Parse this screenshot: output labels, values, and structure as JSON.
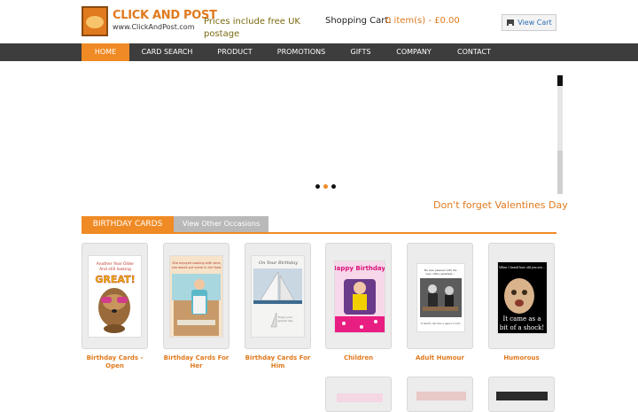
{
  "header": {
    "logo_title": "CLICK AND POST",
    "logo_subtitle": "www.ClickAndPost.com",
    "tagline": "Prices include free UK postage",
    "cart_label": "Shopping Cart:",
    "cart_value": "0 item(s) - £0.00",
    "view_cart": "View Cart",
    "cart_icon": "cart-icon"
  },
  "nav": {
    "items": [
      {
        "label": "HOME",
        "active": true
      },
      {
        "label": "CARD SEARCH",
        "active": false
      },
      {
        "label": "PRODUCT",
        "active": false
      },
      {
        "label": "PROMOTIONS",
        "active": false
      },
      {
        "label": "GIFTS",
        "active": false
      },
      {
        "label": "COMPANY",
        "active": false
      },
      {
        "label": "CONTACT",
        "active": false
      }
    ]
  },
  "slider": {
    "promo_text": "Don't forget Valentines Day",
    "dots": 3,
    "active_dot": 2
  },
  "tabs": {
    "active": "BIRTHDAY CARDS",
    "other": "View Other Occasions"
  },
  "cards": [
    {
      "label": "Birthday Cards - Open",
      "caption": "Another Year Older And still looking GREAT!"
    },
    {
      "label": "Birthday Cards For Her",
      "caption": "She enjoyed cooking with wine, sometimes she would put some in the food."
    },
    {
      "label": "Birthday Cards For Him",
      "caption": "On Your Birthday"
    },
    {
      "label": "Children",
      "caption": "Happy Birthday!"
    },
    {
      "label": "Adult Humour",
      "caption": "He was pleased with his new office assistant."
    },
    {
      "label": "Humorous",
      "caption": "When I heard how old you are... It came as a bit of a shock!"
    }
  ],
  "colors": {
    "accent": "#f08a24",
    "nav_bg": "#3d3d3d",
    "link": "#2a6fb5"
  }
}
